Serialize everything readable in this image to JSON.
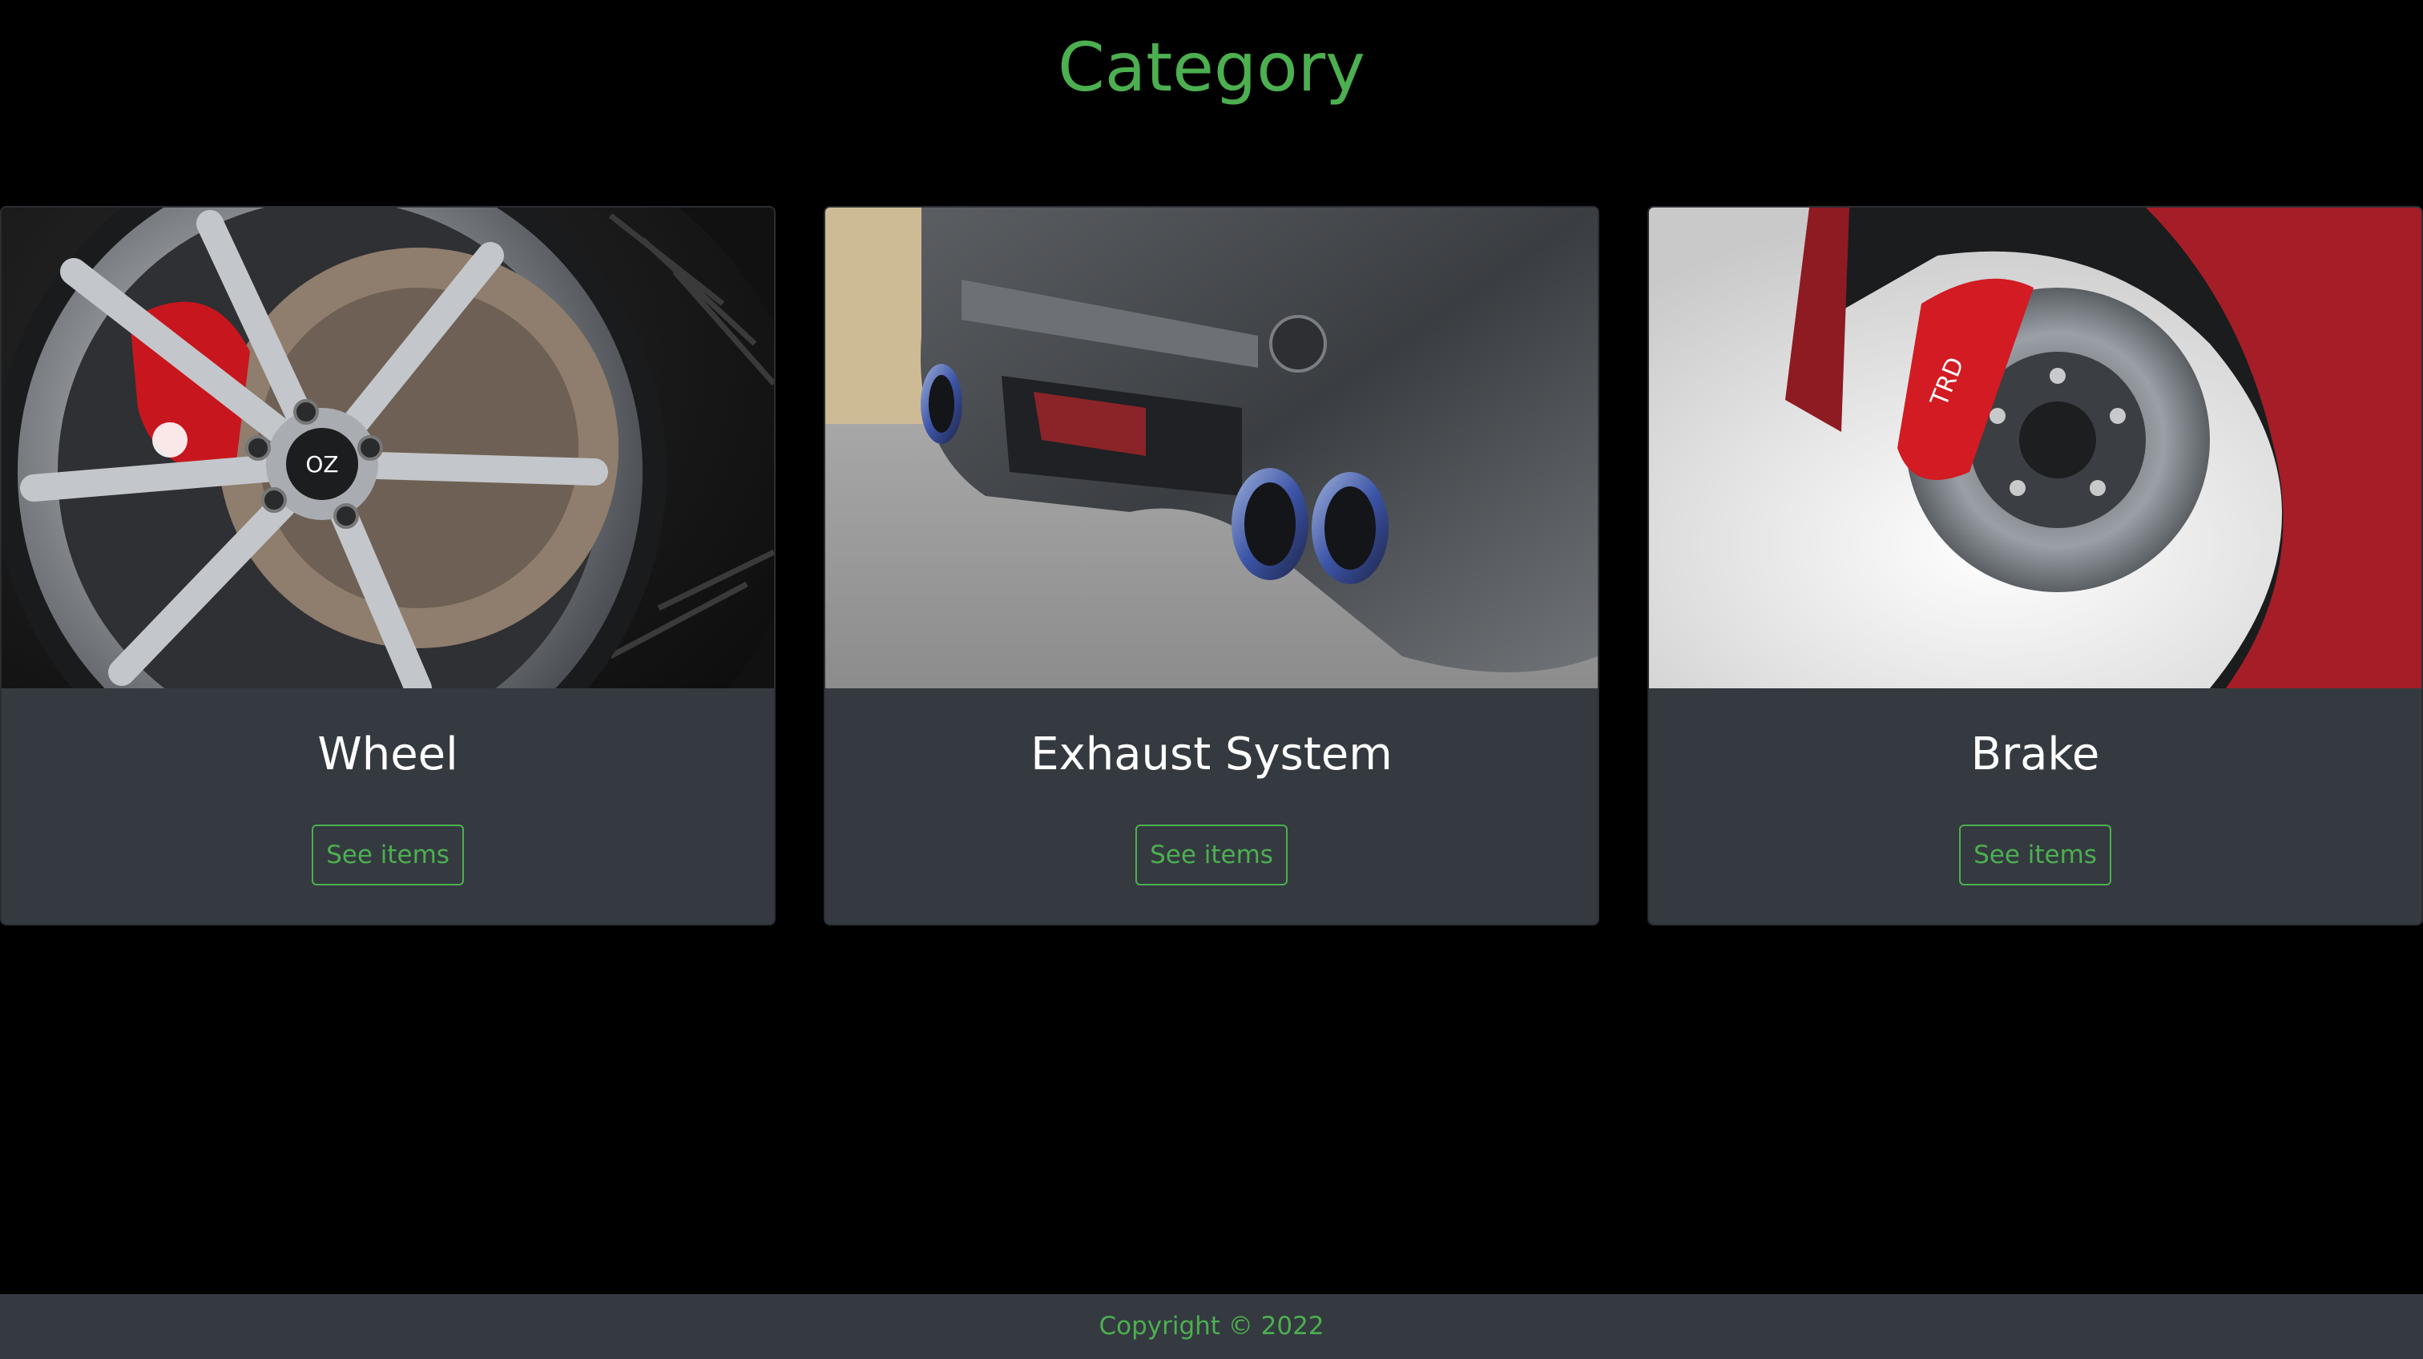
{
  "header": {
    "title": "Category"
  },
  "cards": [
    {
      "title": "Wheel",
      "image": "wheel-photo",
      "button_label": "See items"
    },
    {
      "title": "Exhaust System",
      "image": "exhaust-photo",
      "button_label": "See items"
    },
    {
      "title": "Brake",
      "image": "brake-photo",
      "button_label": "See items"
    }
  ],
  "footer": {
    "text": "Copyright © 2022"
  },
  "colors": {
    "accent": "#4caf50",
    "card_bg": "#343a40",
    "page_bg": "#000000"
  }
}
